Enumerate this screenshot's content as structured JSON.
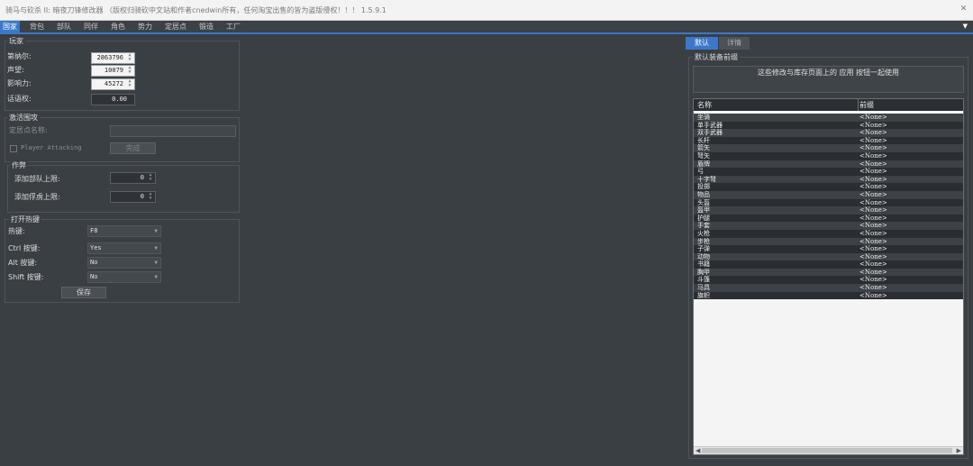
{
  "window": {
    "title": "骑马与砍杀 II: 暗夜刀锋修改器 （版权归骑砍中文站和作者cnedwin所有，任何淘宝出售的皆为盗版侵权！！！ 1.5.9.1",
    "close_icon": "close-icon"
  },
  "menu": {
    "tabs": [
      "国家",
      "背包",
      "部队",
      "同伴",
      "角色",
      "势力",
      "定居点",
      "锻造",
      "工厂"
    ],
    "active": "国家"
  },
  "player": {
    "title": "玩家",
    "denar_label": "第纳尔:",
    "denar_value": "2863796",
    "renown_label": "声望:",
    "renown_value": "10079",
    "influence_label": "影响力:",
    "influence_value": "45272",
    "discourse_label": "话语权:",
    "discourse_value": "0.00"
  },
  "siege": {
    "title": "激活围攻",
    "settlement_label": "定居点名称:",
    "player_attacking_label": "Player Attacking",
    "complete_button": "完成"
  },
  "cheats": {
    "title": "作弊",
    "party_limit_label": "添加部队上限:",
    "party_limit_value": "0",
    "prisoner_limit_label": "添加俘虏上限:",
    "prisoner_limit_value": "0"
  },
  "hotkeys": {
    "title": "打开热键",
    "hotkey_label": "热键:",
    "hotkey_value": "F8",
    "ctrl_label": "Ctrl 按键:",
    "ctrl_value": "Yes",
    "alt_label": "Alt 按键:",
    "alt_value": "No",
    "shift_label": "Shift 按键:",
    "shift_value": "No",
    "save_button": "保存"
  },
  "right_panel": {
    "tabs": [
      "默认",
      "详情"
    ],
    "active": "默认",
    "section_title": "默认装备前缀",
    "note": "这些修改与库存页面上的 应用 按钮一起使用",
    "columns": [
      "名称",
      "前缀"
    ],
    "rows": [
      [
        "坐骑",
        "<None>"
      ],
      [
        "单手武器",
        "<None>"
      ],
      [
        "双手武器",
        "<None>"
      ],
      [
        "长杆",
        "<None>"
      ],
      [
        "箭矢",
        "<None>"
      ],
      [
        "弩矢",
        "<None>"
      ],
      [
        "盾牌",
        "<None>"
      ],
      [
        "弓",
        "<None>"
      ],
      [
        "十字弩",
        "<None>"
      ],
      [
        "投掷",
        "<None>"
      ],
      [
        "物品",
        "<None>"
      ],
      [
        "头盔",
        "<None>"
      ],
      [
        "盔甲",
        "<None>"
      ],
      [
        "护腿",
        "<None>"
      ],
      [
        "手套",
        "<None>"
      ],
      [
        "火枪",
        "<None>"
      ],
      [
        "步枪",
        "<None>"
      ],
      [
        "子弹",
        "<None>"
      ],
      [
        "动物",
        "<None>"
      ],
      [
        "书籍",
        "<None>"
      ],
      [
        "胸甲",
        "<None>"
      ],
      [
        "斗篷",
        "<None>"
      ],
      [
        "马具",
        "<None>"
      ],
      [
        "旗帜",
        "<None>"
      ]
    ]
  }
}
